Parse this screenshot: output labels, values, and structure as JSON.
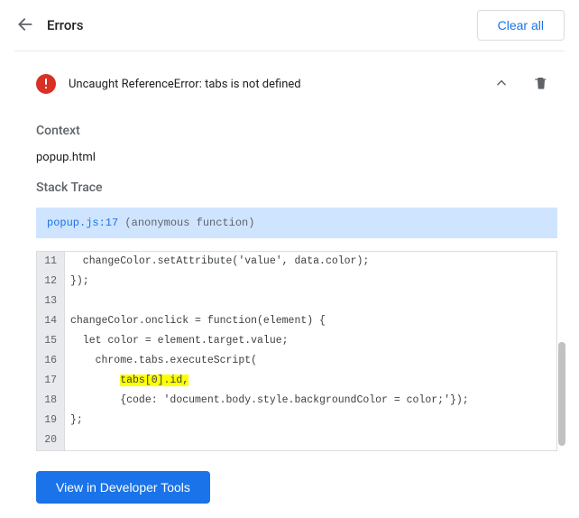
{
  "header": {
    "title": "Errors",
    "clear_all": "Clear all"
  },
  "error": {
    "message": "Uncaught ReferenceError: tabs is not defined"
  },
  "context": {
    "heading": "Context",
    "value": "popup.html"
  },
  "trace": {
    "heading": "Stack Trace",
    "location": "popup.js:17",
    "fn": "(anonymous function)"
  },
  "code": {
    "lines": [
      {
        "n": "11",
        "text": "  changeColor.setAttribute('value', data.color);",
        "hl": false
      },
      {
        "n": "12",
        "text": "});",
        "hl": false
      },
      {
        "n": "13",
        "text": "",
        "hl": false
      },
      {
        "n": "14",
        "text": "changeColor.onclick = function(element) {",
        "hl": false
      },
      {
        "n": "15",
        "text": "  let color = element.target.value;",
        "hl": false
      },
      {
        "n": "16",
        "text": "    chrome.tabs.executeScript(",
        "hl": false
      },
      {
        "n": "17",
        "text": "        tabs[0].id,",
        "hl": true
      },
      {
        "n": "18",
        "text": "        {code: 'document.body.style.backgroundColor = color;'});",
        "hl": false
      },
      {
        "n": "19",
        "text": "};",
        "hl": false
      },
      {
        "n": "20",
        "text": "",
        "hl": false
      }
    ]
  },
  "footer": {
    "dev_tools": "View in Developer Tools"
  }
}
